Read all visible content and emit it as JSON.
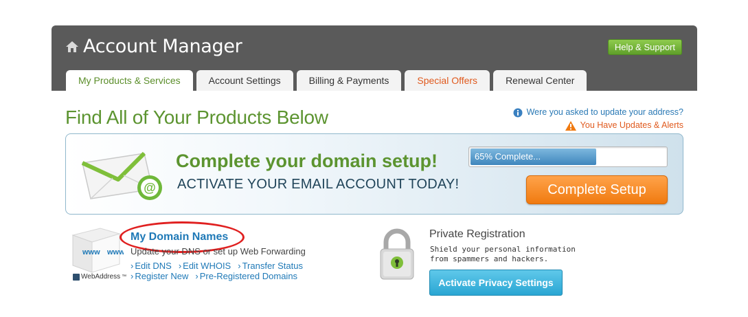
{
  "header": {
    "title": "Account Manager",
    "help_label": "Help & Support"
  },
  "tabs": [
    {
      "label": "My Products & Services",
      "active": true
    },
    {
      "label": "Account Settings"
    },
    {
      "label": "Billing & Payments"
    },
    {
      "label": "Special Offers"
    },
    {
      "label": "Renewal Center"
    }
  ],
  "main": {
    "title": "Find All of Your Products Below",
    "alerts": {
      "address_question": "Were you asked to update your address?",
      "updates": "You Have Updates & Alerts"
    }
  },
  "banner": {
    "headline": "Complete your domain setup!",
    "subline": "ACTIVATE YOUR EMAIL ACCOUNT TODAY!",
    "progress_label": "65% Complete...",
    "progress_fraction": 0.65,
    "button_label": "Complete Setup"
  },
  "domains": {
    "title": "My Domain Names",
    "description": "Update your DNS or set up Web Forwarding",
    "product_image_text": "www",
    "brand": "WebAddress",
    "trademark": "™",
    "links_row1": [
      "Edit DNS",
      "Edit WHOIS",
      "Transfer Status"
    ],
    "links_row2": [
      "Register New",
      "Pre-Registered Domains"
    ]
  },
  "privacy": {
    "title": "Private Registration",
    "description": "Shield your personal information from spammers and hackers.",
    "button_label": "Activate Privacy Settings"
  },
  "colors": {
    "accent_green": "#5c9430",
    "link_blue": "#1f79b7",
    "alert_orange": "#e05a1e",
    "cta_orange": "#f07a10",
    "highlight_red": "#e02020"
  },
  "icons": [
    "home-icon",
    "info-icon",
    "warning-icon",
    "envelope-icon",
    "lock-icon",
    "www-cube-icon"
  ]
}
